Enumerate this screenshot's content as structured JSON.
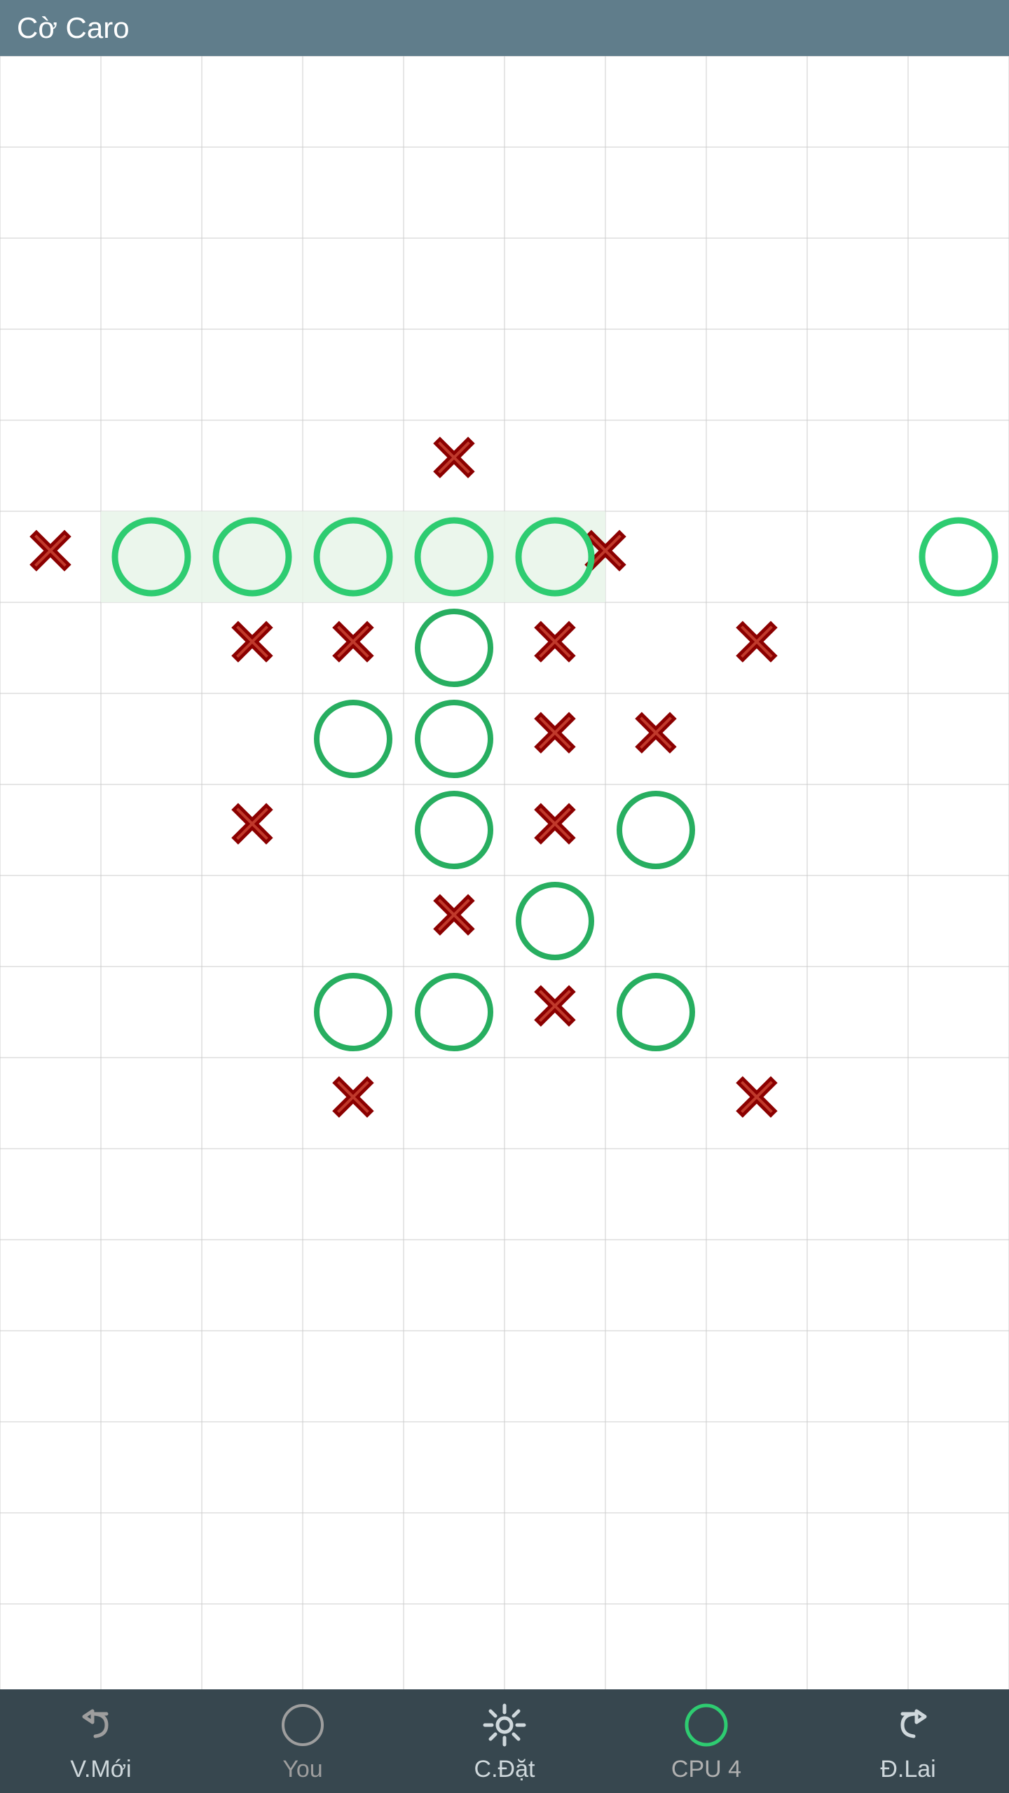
{
  "header": {
    "title": "Cờ Caro"
  },
  "board": {
    "cols": 10,
    "rows": 18,
    "cell_size_x": 144,
    "cell_size_y": 130,
    "pieces": [
      {
        "row": 4,
        "col": 4,
        "type": "X"
      },
      {
        "row": 5,
        "col": 0,
        "type": "X"
      },
      {
        "row": 5,
        "col": 1,
        "type": "O",
        "highlight": true
      },
      {
        "row": 5,
        "col": 2,
        "type": "O",
        "highlight": true
      },
      {
        "row": 5,
        "col": 3,
        "type": "O",
        "highlight": true
      },
      {
        "row": 5,
        "col": 4,
        "type": "O",
        "highlight": true
      },
      {
        "row": 5,
        "col": 5,
        "type": "O",
        "highlight": true
      },
      {
        "row": 5,
        "col": 6,
        "type": "X"
      },
      {
        "row": 5,
        "col": 9,
        "type": "O"
      },
      {
        "row": 6,
        "col": 2,
        "type": "X"
      },
      {
        "row": 6,
        "col": 3,
        "type": "X"
      },
      {
        "row": 6,
        "col": 4,
        "type": "O"
      },
      {
        "row": 6,
        "col": 5,
        "type": "X"
      },
      {
        "row": 6,
        "col": 7,
        "type": "X"
      },
      {
        "row": 7,
        "col": 3,
        "type": "O"
      },
      {
        "row": 7,
        "col": 4,
        "type": "O"
      },
      {
        "row": 7,
        "col": 5,
        "type": "X"
      },
      {
        "row": 7,
        "col": 6,
        "type": "X"
      },
      {
        "row": 8,
        "col": 2,
        "type": "X"
      },
      {
        "row": 8,
        "col": 4,
        "type": "O"
      },
      {
        "row": 8,
        "col": 5,
        "type": "X"
      },
      {
        "row": 8,
        "col": 6,
        "type": "O"
      },
      {
        "row": 9,
        "col": 4,
        "type": "X"
      },
      {
        "row": 9,
        "col": 5,
        "type": "O"
      },
      {
        "row": 10,
        "col": 3,
        "type": "O"
      },
      {
        "row": 10,
        "col": 4,
        "type": "O"
      },
      {
        "row": 10,
        "col": 5,
        "type": "X"
      },
      {
        "row": 10,
        "col": 6,
        "type": "O"
      },
      {
        "row": 11,
        "col": 3,
        "type": "X"
      },
      {
        "row": 11,
        "col": 7,
        "type": "X"
      }
    ]
  },
  "footer": {
    "buttons": [
      {
        "id": "vnew",
        "label": "V.Mới",
        "icon": "undo-left"
      },
      {
        "id": "you",
        "label": "You",
        "icon": "circle-small"
      },
      {
        "id": "cdat",
        "label": "C.Đặt",
        "icon": "gear"
      },
      {
        "id": "cpu4",
        "label": "CPU 4",
        "icon": "circle-green"
      },
      {
        "id": "dlai",
        "label": "Đ.Lai",
        "icon": "undo-right"
      }
    ]
  }
}
